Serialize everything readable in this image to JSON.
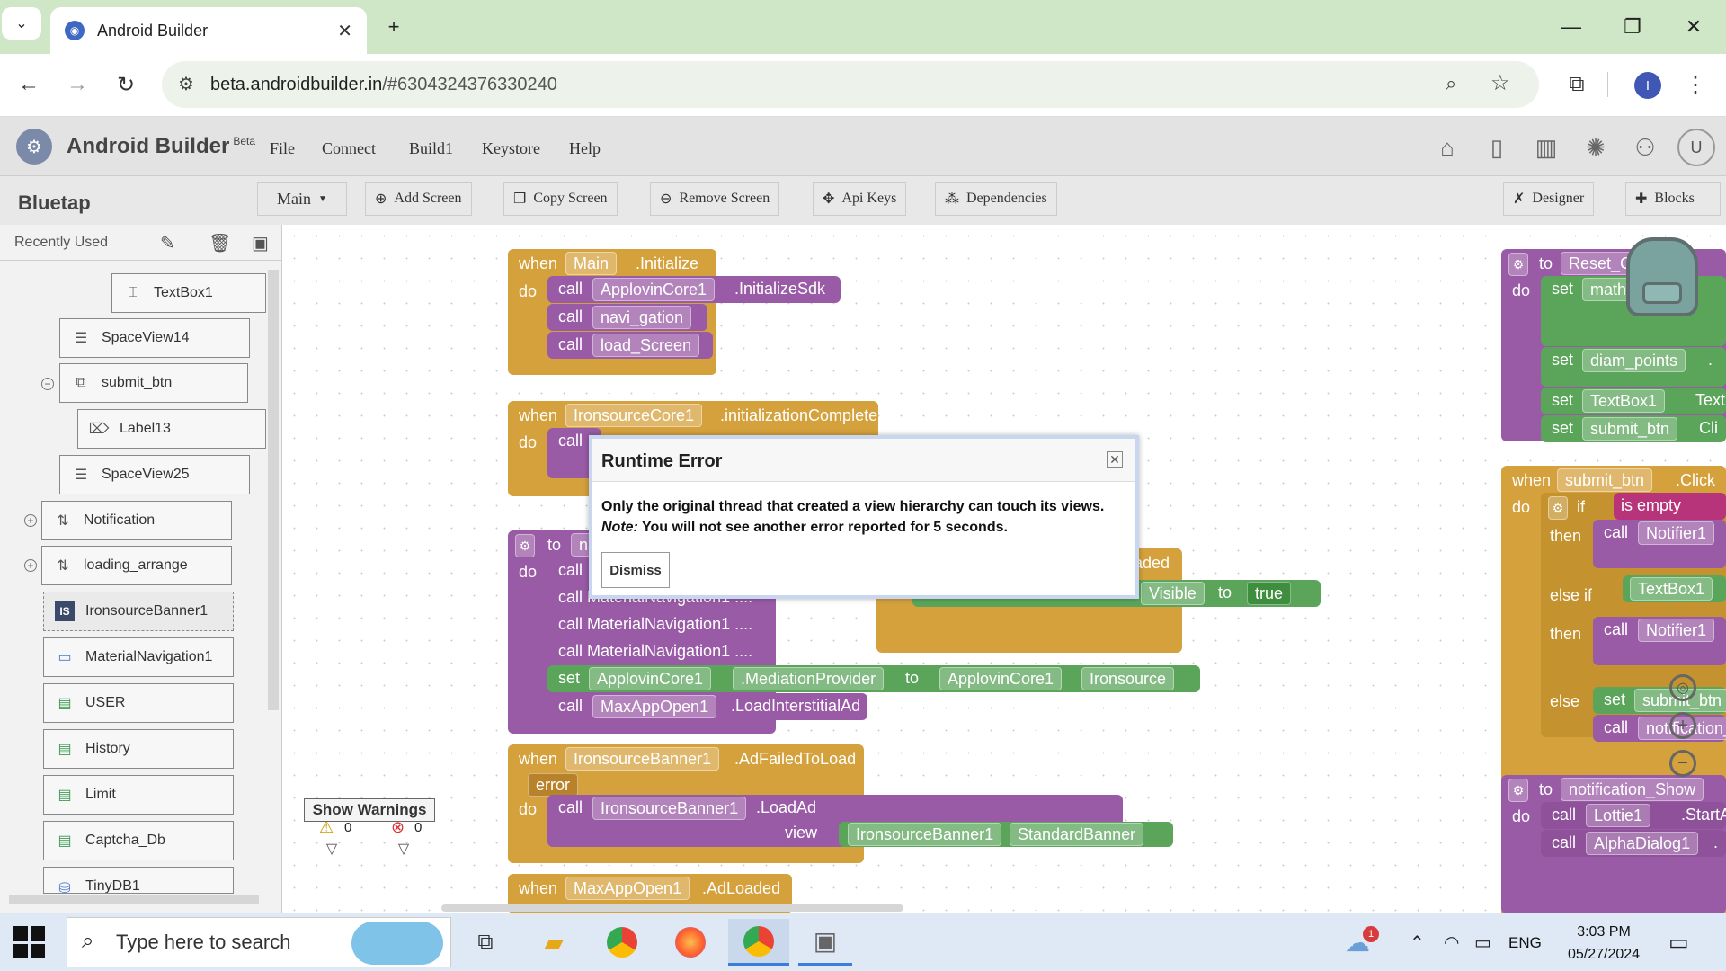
{
  "browser": {
    "tab_title": "Android Builder",
    "url_host": "beta.androidbuilder.in",
    "url_path": "/#6304324376330240",
    "profile_initial": "I"
  },
  "app": {
    "name": "Android Builder",
    "badge": "Beta",
    "menu": [
      "File",
      "Connect",
      "Build1",
      "Keystore",
      "Help"
    ],
    "user_initial": "U",
    "project": "Bluetap",
    "screen_select": "Main",
    "toolbar": {
      "add_screen": "Add Screen",
      "copy_screen": "Copy Screen",
      "remove_screen": "Remove Screen",
      "api_keys": "Api Keys",
      "dependencies": "Dependencies",
      "designer": "Designer",
      "blocks": "Blocks"
    }
  },
  "palette": {
    "header": "Recently Used",
    "items": [
      {
        "label": "TextBox1",
        "icon": "textbox-icon"
      },
      {
        "label": "SpaceView14",
        "icon": "spaceview-icon"
      },
      {
        "label": "submit_btn",
        "icon": "button-icon"
      },
      {
        "label": "Label13",
        "icon": "label-icon"
      },
      {
        "label": "SpaceView25",
        "icon": "spaceview-icon"
      },
      {
        "label": "Notification",
        "icon": "arrangement-icon"
      },
      {
        "label": "loading_arrange",
        "icon": "arrangement-icon"
      },
      {
        "label": "IronsourceBanner1",
        "icon": "ironsource-icon"
      },
      {
        "label": "MaterialNavigation1",
        "icon": "navigation-icon"
      },
      {
        "label": "USER",
        "icon": "database-icon"
      },
      {
        "label": "History",
        "icon": "database-icon"
      },
      {
        "label": "Limit",
        "icon": "database-icon"
      },
      {
        "label": "Captcha_Db",
        "icon": "database-icon"
      },
      {
        "label": "TinyDB1",
        "icon": "database-icon"
      }
    ]
  },
  "blocks": {
    "init": {
      "when": "when",
      "comp": "Main",
      "event": ".Initialize",
      "do": "do",
      "calls": [
        {
          "call": "call",
          "comp": "ApplovinCore1",
          "method": ".InitializeSdk"
        },
        {
          "call": "call",
          "comp": "navi_gation"
        },
        {
          "call": "call",
          "comp": "load_Screen"
        }
      ]
    },
    "iron": {
      "when": "when",
      "comp": "IronsourceCore1",
      "event": ".initializationComplete",
      "do": "do",
      "call": "call"
    },
    "nav": {
      "to": "to",
      "name": "na",
      "do": "do",
      "rows": [
        "call",
        "call MaterialNavigation1 ....",
        "call MaterialNavigation1 ....",
        "call MaterialNavigation1 ...."
      ],
      "set": "set",
      "set_comp": "ApplovinCore1",
      "set_prop": ".MediationProvider",
      "set_to": "to",
      "set_val_comp": "ApplovinCore1",
      "set_val": "Ironsource",
      "call2": "call",
      "call2_comp": "MaxAppOpen1",
      "call2_method": ".LoadInterstitialAd"
    },
    "loaded_frag": "aded",
    "visible_frag": {
      "prop": "Visible",
      "to": "to",
      "val": "true"
    },
    "failed": {
      "when": "when",
      "comp": "IronsourceBanner1",
      "event": ".AdFailedToLoad",
      "param": "error",
      "do": "do",
      "call": "call",
      "call_comp": "IronsourceBanner1",
      "call_method": ".LoadAd",
      "view": "view",
      "view_comp": "IronsourceBanner1",
      "view_val": "StandardBanner"
    },
    "maxapp": {
      "when": "when",
      "comp": "MaxAppOpen1",
      "event": ".AdLoaded"
    },
    "reset": {
      "to": "to",
      "name": "Reset_Ca",
      "do": "do",
      "rows": [
        {
          "set": "set",
          "comp": "math"
        },
        {
          "set": "set",
          "comp": "diam_points",
          "extra": "."
        },
        {
          "set": "set",
          "comp": "TextBox1",
          "extra": "Text"
        },
        {
          "set": "set",
          "comp": "submit_btn",
          "extra": "Cli"
        }
      ]
    },
    "click": {
      "when": "when",
      "comp": "submit_btn",
      "event": ".Click",
      "do": "do",
      "if": "if",
      "is_empty": "is empty",
      "then": "then",
      "call": "call",
      "notifier": "Notifier1",
      "else_if": "else if",
      "textbox": "TextBox1",
      "then2": "then",
      "call2": "call",
      "notifier2": "Notifier1",
      "else": "else",
      "set": "set",
      "set_comp": "submit_btn",
      "call3": "call",
      "call3_comp": "notification_"
    },
    "notif": {
      "to": "to",
      "name": "notification_Show",
      "do": "do",
      "rows": [
        {
          "call": "call",
          "comp": "Lottie1",
          "method": ".StartAni"
        },
        {
          "call": "call",
          "comp": "AlphaDialog1",
          "method": "."
        }
      ]
    }
  },
  "warnings": {
    "warn_count": "0",
    "error_count": "0",
    "button": "Show Warnings"
  },
  "dialog": {
    "title": "Runtime Error",
    "message": "Only the original thread that created a view hierarchy can touch its views.",
    "note_label": "Note:",
    "note_text": " You will not see another error reported for 5 seconds.",
    "dismiss": "Dismiss"
  },
  "taskbar": {
    "search_placeholder": "Type here to search",
    "language": "ENG",
    "time": "3:03 PM",
    "date": "05/27/2024",
    "weather_badge": "1"
  }
}
